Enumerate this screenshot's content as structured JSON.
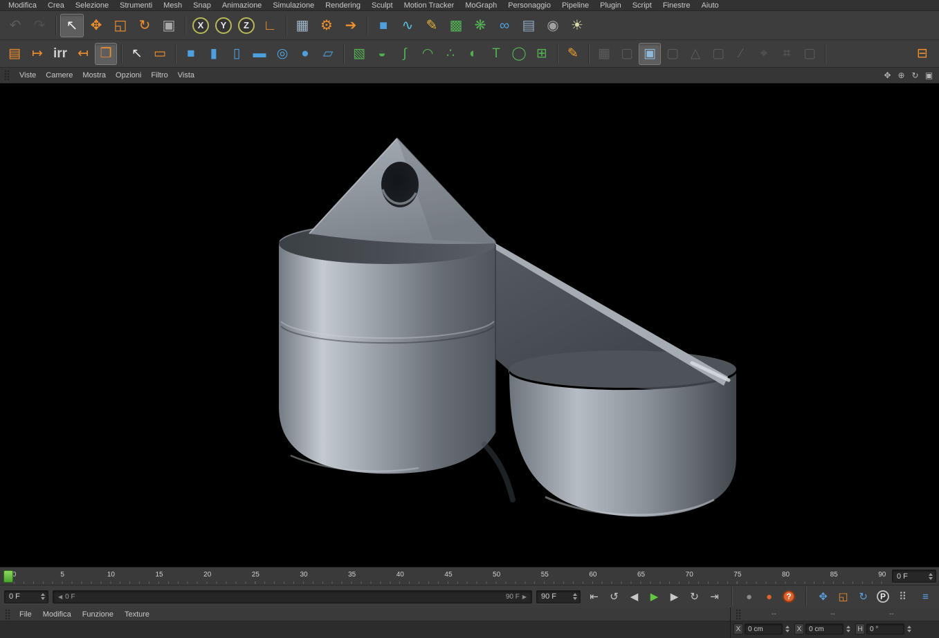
{
  "colors": {
    "chrome": "#3d3d3d",
    "chrome_dark": "#323232",
    "viewport_bg": "#000000",
    "accent_orange": "#ef8f2d",
    "accent_blue": "#4f9fdd",
    "accent_green": "#53b153",
    "play_green": "#62c93f",
    "text": "#c6c6c6",
    "model_grey": "#9aa0a8"
  },
  "menubar": {
    "items": [
      "Modifica",
      "Crea",
      "Selezione",
      "Strumenti",
      "Mesh",
      "Snap",
      "Animazione",
      "Simulazione",
      "Rendering",
      "Sculpt",
      "Motion Tracker",
      "MoGraph",
      "Personaggio",
      "Pipeline",
      "Plugin",
      "Script",
      "Finestre",
      "Aiuto"
    ]
  },
  "toolbar1": {
    "groups": [
      [
        {
          "n": "undo-icon",
          "g": "↶",
          "c": "#9a9a9a",
          "dis": true
        },
        {
          "n": "redo-icon",
          "g": "↷",
          "c": "#757575",
          "dis": true
        }
      ],
      [
        {
          "n": "live-selection-tool-icon",
          "g": "↖",
          "c": "#f0f0f0",
          "pr": true
        },
        {
          "n": "move-tool-icon",
          "g": "✥",
          "c": "#ef8f2d"
        },
        {
          "n": "scale-tool-icon",
          "g": "◱",
          "c": "#ef8f2d"
        },
        {
          "n": "rotate-tool-icon",
          "g": "↻",
          "c": "#ef8f2d"
        },
        {
          "n": "last-used-tool-icon",
          "g": "▣",
          "c": "#a8a8a8"
        }
      ],
      [
        {
          "n": "lock-x-axis-button",
          "g": "X",
          "shape": "circle",
          "bd": "#b9b95a",
          "c": "#e8e8e8"
        },
        {
          "n": "lock-y-axis-button",
          "g": "Y",
          "shape": "circle",
          "bd": "#b9b95a",
          "c": "#e8e8e8"
        },
        {
          "n": "lock-z-axis-button",
          "g": "Z",
          "shape": "circle",
          "bd": "#b9b95a",
          "c": "#e8e8e8"
        },
        {
          "n": "coordinate-system-button",
          "g": "∟",
          "c": "#ef8f2d"
        }
      ],
      [
        {
          "n": "render-view-button",
          "g": "▦",
          "c": "#9fb6c6"
        },
        {
          "n": "render-settings-button",
          "g": "⚙",
          "c": "#ef8f2d"
        },
        {
          "n": "render-queue-button",
          "g": "➔",
          "c": "#ef8f2d"
        }
      ],
      [
        {
          "n": "add-cube-button",
          "g": "■",
          "c": "#4f9fdd"
        },
        {
          "n": "spline-pen-button",
          "g": "∿",
          "c": "#55c3e0"
        },
        {
          "n": "freehand-pen-button",
          "g": "✎",
          "c": "#e8b43a"
        },
        {
          "n": "subdivision-surface-button",
          "g": "▩",
          "c": "#53b153"
        },
        {
          "n": "cloner-button",
          "g": "❋",
          "c": "#53b153"
        },
        {
          "n": "metaball-button",
          "g": "∞",
          "c": "#4f9fdd"
        },
        {
          "n": "floor-button",
          "g": "▤",
          "c": "#8fa8c0"
        },
        {
          "n": "camera-button",
          "g": "◉",
          "c": "#a0a0a0"
        },
        {
          "n": "light-button",
          "g": "☀",
          "c": "#d8d8a8"
        }
      ]
    ]
  },
  "toolbar2": {
    "groups": [
      [
        {
          "n": "render-preview-icon",
          "g": "▤",
          "c": "#ef8f2d"
        },
        {
          "n": "make-preview-icon",
          "g": "↦",
          "c": "#ef8f2d"
        },
        {
          "n": "irr-cache-icon",
          "g": "irr",
          "c": "#cfcfcf",
          "small": true
        },
        {
          "n": "flush-caches-icon",
          "g": "↤",
          "c": "#ef8f2d"
        },
        {
          "n": "preview-window-icon",
          "g": "❒",
          "c": "#ef8f2d",
          "pr": true
        }
      ],
      [
        {
          "n": "selection-arrow-icon",
          "g": "↖",
          "c": "#e8e8e8"
        },
        {
          "n": "rectangle-selection-icon",
          "g": "▭",
          "c": "#ef8f2d"
        }
      ],
      [
        {
          "n": "cube-primitive-icon",
          "g": "■",
          "c": "#4f9fdd"
        },
        {
          "n": "cylinder-primitive-icon",
          "g": "▮",
          "c": "#4f9fdd"
        },
        {
          "n": "tube-primitive-icon",
          "g": "▯",
          "c": "#4f9fdd"
        },
        {
          "n": "disc-primitive-icon",
          "g": "▬",
          "c": "#4f9fdd"
        },
        {
          "n": "torus-primitive-icon",
          "g": "◎",
          "c": "#4f9fdd"
        },
        {
          "n": "sphere-primitive-icon",
          "g": "●",
          "c": "#4f9fdd"
        },
        {
          "n": "plane-primitive-icon",
          "g": "▱",
          "c": "#4f9fdd"
        }
      ],
      [
        {
          "n": "subdivision-icon",
          "g": "▧",
          "c": "#53b153"
        },
        {
          "n": "lathe-icon",
          "g": "◒",
          "c": "#53b153"
        },
        {
          "n": "sweep-icon",
          "g": "∫",
          "c": "#53b153"
        },
        {
          "n": "loft-icon",
          "g": "◠",
          "c": "#53b153"
        },
        {
          "n": "atom-array-icon",
          "g": "∴",
          "c": "#53b153"
        },
        {
          "n": "boole-icon",
          "g": "◐",
          "c": "#53b153"
        },
        {
          "n": "text-object-icon",
          "g": "T",
          "c": "#53b153"
        },
        {
          "n": "instance-icon",
          "g": "◯",
          "c": "#53b153"
        },
        {
          "n": "array-icon",
          "g": "⊞",
          "c": "#53b153"
        }
      ],
      [
        {
          "n": "sculpt-pen-icon",
          "g": "✎",
          "c": "#f0a22e"
        }
      ],
      [
        {
          "n": "polygon-plane-icon",
          "g": "▦",
          "c": "#9a9a9a",
          "dis": true
        },
        {
          "n": "mesh-cube-icon",
          "g": "▢",
          "c": "#9a9a9a",
          "dis": true
        },
        {
          "n": "current-mode-icon",
          "g": "▣",
          "c": "#8fb8d8",
          "pr": true
        },
        {
          "n": "mesh-cube2-icon",
          "g": "▢",
          "c": "#9a9a9a",
          "dis": true
        },
        {
          "n": "mesh-prism-icon",
          "g": "△",
          "c": "#9a9a9a",
          "dis": true
        },
        {
          "n": "mesh-cube3-icon",
          "g": "▢",
          "c": "#9a9a9a",
          "dis": true
        },
        {
          "n": "knife-tool-icon",
          "g": "∕",
          "c": "#9a9a9a",
          "dis": true
        },
        {
          "n": "axis-tool-icon",
          "g": "⌖",
          "c": "#9a9a9a",
          "dis": true
        },
        {
          "n": "axis-snap-icon",
          "g": "⌗",
          "c": "#9a9a9a",
          "dis": true
        },
        {
          "n": "mesh-cube4-icon",
          "g": "▢",
          "c": "#9a9a9a",
          "dis": true
        }
      ],
      [
        {
          "n": "measure-scale-icon",
          "g": "⊟",
          "c": "#ef8f2d",
          "right": true
        }
      ]
    ]
  },
  "viewport_menu": {
    "items": [
      "Viste",
      "Camere",
      "Mostra",
      "Opzioni",
      "Filtro",
      "Vista"
    ],
    "nav_icons": [
      {
        "n": "pan-view-icon",
        "g": "✥",
        "c": "#b5b5b5"
      },
      {
        "n": "zoom-view-icon",
        "g": "⊕",
        "c": "#b5b5b5"
      },
      {
        "n": "rotate-view-icon",
        "g": "↻",
        "c": "#b5b5b5"
      },
      {
        "n": "toggle-view-icon",
        "g": "▣",
        "c": "#b5b5b5"
      }
    ]
  },
  "timeline": {
    "ticks": [
      "0",
      "5",
      "10",
      "15",
      "20",
      "25",
      "30",
      "35",
      "40",
      "45",
      "50",
      "55",
      "60",
      "65",
      "70",
      "75",
      "80",
      "85",
      "90"
    ],
    "frame_field": "0 F"
  },
  "transport": {
    "current_frame": "0 F",
    "range_start_label": "0 F",
    "range_end_label": "90 F",
    "end_frame": "90 F",
    "left_arrow": "◀",
    "right_arrow": "▶",
    "buttons": [
      {
        "n": "goto-start-button",
        "g": "⇤",
        "c": "#c8c8c8"
      },
      {
        "n": "prev-key-button",
        "g": "↺",
        "c": "#c8c8c8"
      },
      {
        "n": "prev-frame-button",
        "g": "◀",
        "c": "#c8c8c8"
      },
      {
        "n": "play-button",
        "g": "▶",
        "c": "#62c93f"
      },
      {
        "n": "next-frame-button",
        "g": "▶",
        "c": "#c8c8c8"
      },
      {
        "n": "next-key-button",
        "g": "↻",
        "c": "#c8c8c8"
      },
      {
        "n": "goto-end-button",
        "g": "⇥",
        "c": "#c8c8c8"
      }
    ],
    "record": [
      {
        "n": "record-objects-button",
        "g": "●",
        "c": "#8a8a8a"
      },
      {
        "n": "record-keyframe-button",
        "g": "●",
        "c": "#e0622a"
      },
      {
        "n": "autokey-button",
        "g": "?",
        "shape": "circle",
        "bg": "#e0622a",
        "bd": "#8a3a12",
        "c": "#ffffff"
      }
    ],
    "toggles": [
      {
        "n": "record-position-button",
        "g": "✥",
        "c": "#5aa0e0"
      },
      {
        "n": "record-scale-button",
        "g": "◱",
        "c": "#ef8f2d"
      },
      {
        "n": "record-rotation-button",
        "g": "↻",
        "c": "#5aa0e0"
      },
      {
        "n": "record-parameter-button",
        "g": "P",
        "shape": "circle",
        "bd": "#bbbbbb",
        "c": "#eeeeee"
      },
      {
        "n": "record-pla-button",
        "g": "⠿",
        "c": "#bcbcbc"
      }
    ],
    "extra": [
      {
        "n": "timeline-layout-button",
        "g": "≡",
        "c": "#5aa0e0"
      }
    ]
  },
  "materials": {
    "menu": [
      "File",
      "Modifica",
      "Funzione",
      "Texture"
    ]
  },
  "coordinates": {
    "headers": [
      "--",
      "--",
      "--"
    ],
    "fields": [
      {
        "label": "X",
        "value": "0 cm"
      },
      {
        "label": "X",
        "value": "0 cm"
      },
      {
        "label": "H",
        "value": "0 °"
      }
    ]
  }
}
